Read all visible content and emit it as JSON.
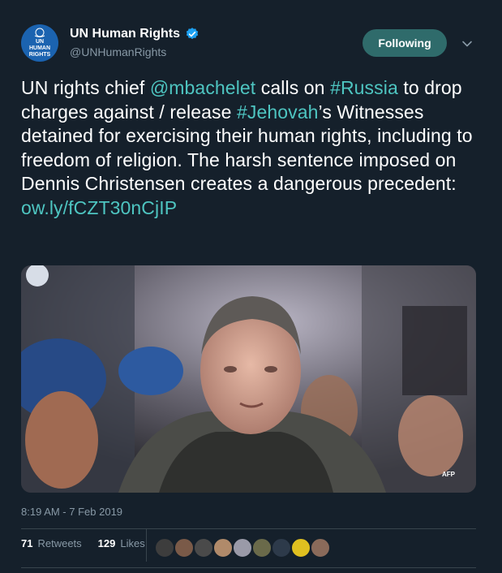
{
  "account": {
    "display_name": "UN Human Rights",
    "handle": "@UNHumanRights",
    "avatar_lines": [
      "UN",
      "HUMAN",
      "RIGHTS"
    ],
    "verified_icon": "verified-badge-icon"
  },
  "follow_button": {
    "label": "Following"
  },
  "tweet": {
    "segments": [
      {
        "text": "UN rights chief ",
        "highlight": false
      },
      {
        "text": "@mbachelet",
        "highlight": true
      },
      {
        "text": " calls on ",
        "highlight": false
      },
      {
        "text": "#Russia",
        "highlight": true
      },
      {
        "text": " to drop charges against / release ",
        "highlight": false
      },
      {
        "text": "#Jehovah",
        "highlight": true
      },
      {
        "text": "’s Witnesses detained for exercising their human rights, including to freedom of religion. The harsh sentence imposed on Dennis Christensen creates a dangerous precedent: ",
        "highlight": false
      },
      {
        "text": "ow.ly/fCZT30nCjIP",
        "highlight": true
      }
    ],
    "media_watermark": "AFP",
    "timestamp": "8:19 AM - 7 Feb 2019"
  },
  "stats": {
    "retweets_count": "71",
    "retweets_label": "Retweets",
    "likes_count": "129",
    "likes_label": "Likes"
  },
  "colors": {
    "background": "#15202b",
    "accent": "#4ec5c1",
    "follow_button": "#2f6b6b",
    "secondary_text": "#8899a6"
  }
}
